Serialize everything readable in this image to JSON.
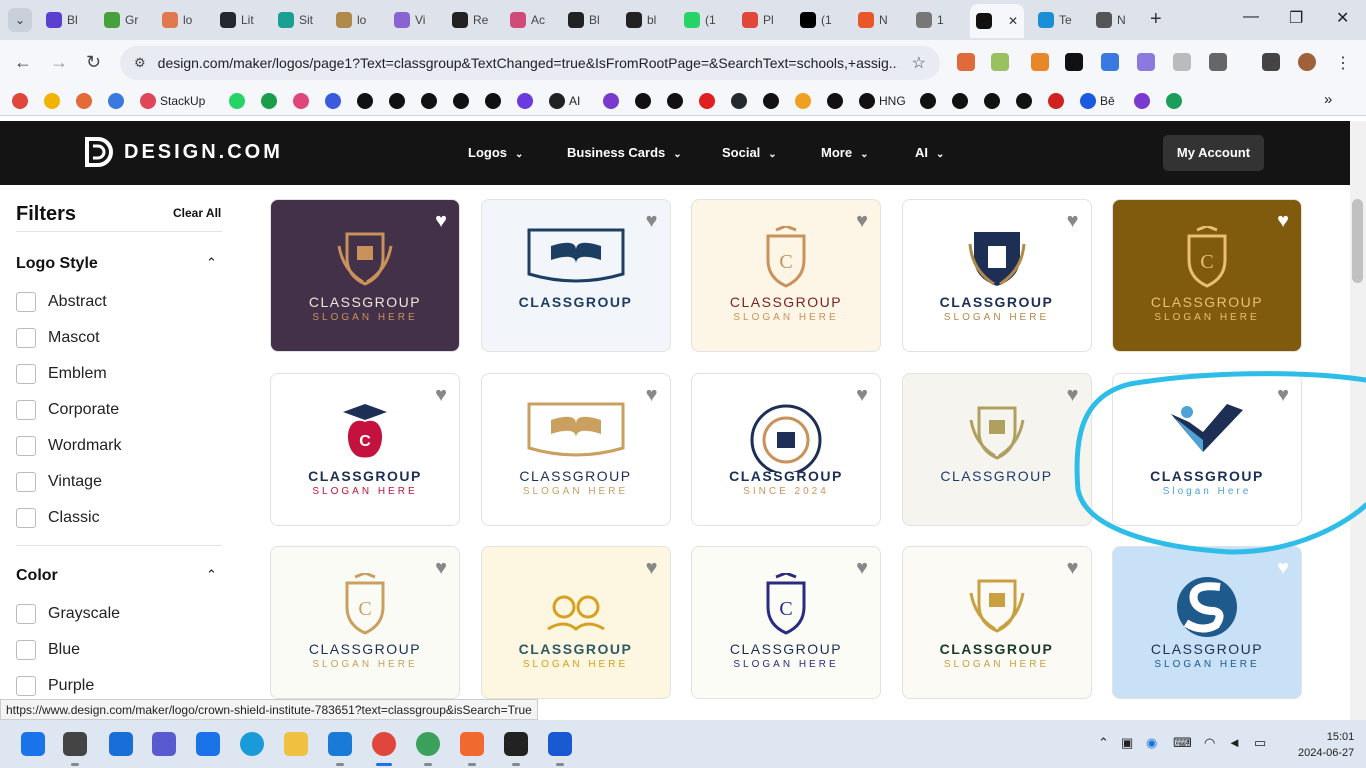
{
  "browser": {
    "tabs": [
      {
        "label": "Bl",
        "color": "#5b3fd1"
      },
      {
        "label": "Gr",
        "color": "#45a23a"
      },
      {
        "label": "lo",
        "color": "#e07a4e"
      },
      {
        "label": "Lit",
        "color": "#24292f"
      },
      {
        "label": "Sit",
        "color": "#1aa090"
      },
      {
        "label": "lo",
        "color": "#b08a4a"
      },
      {
        "label": "Vi",
        "color": "#8a63d2"
      },
      {
        "label": "Re",
        "color": "#222222"
      },
      {
        "label": "Ac",
        "color": "#d14a7a"
      },
      {
        "label": "Bl",
        "color": "#222222"
      },
      {
        "label": "bl",
        "color": "#222222"
      },
      {
        "label": "(1",
        "color": "#25d366"
      },
      {
        "label": "Pl",
        "color": "#e0463a"
      },
      {
        "label": "(1",
        "color": "#000000"
      },
      {
        "label": "N",
        "color": "#e8572a"
      },
      {
        "label": "1",
        "color": "#777777"
      },
      {
        "label": "",
        "color": "#111111"
      },
      {
        "label": "Te",
        "color": "#1a8fd8"
      },
      {
        "label": "N",
        "color": "#555555"
      }
    ],
    "active_close": "✕",
    "new_tab": "+",
    "window_controls": {
      "minimize": "—",
      "maximize": "❐",
      "close": "✕"
    },
    "url": "design.com/maker/logos/page1?Text=classgroup&TextChanged=true&IsFromRootPage=&SearchText=schools,+assig...",
    "nav": {
      "back": "←",
      "forward": "→",
      "reload": "↻",
      "star": "☆"
    },
    "bookmarks": [
      {
        "label": "",
        "color": "#e0463a"
      },
      {
        "label": "",
        "color": "#f0b400"
      },
      {
        "label": "",
        "color": "#e46a3a"
      },
      {
        "label": "",
        "color": "#3a7ae0"
      },
      {
        "label": "StackUp",
        "color": "#e0465a"
      },
      {
        "label": "",
        "color": "#25d366"
      },
      {
        "label": "",
        "color": "#1a9e4a"
      },
      {
        "label": "",
        "color": "#e0467a"
      },
      {
        "label": "",
        "color": "#3a5ae0"
      },
      {
        "label": "",
        "color": "#111111"
      },
      {
        "label": "",
        "color": "#111111"
      },
      {
        "label": "",
        "color": "#111111"
      },
      {
        "label": "",
        "color": "#111111"
      },
      {
        "label": "",
        "color": "#111111"
      },
      {
        "label": "",
        "color": "#6a3ae0"
      },
      {
        "label": "AI",
        "color": "#222222"
      },
      {
        "label": "",
        "color": "#7a3ad0"
      },
      {
        "label": "",
        "color": "#111111"
      },
      {
        "label": "",
        "color": "#111111"
      },
      {
        "label": "",
        "color": "#e02020"
      },
      {
        "label": "",
        "color": "#24292f"
      },
      {
        "label": "",
        "color": "#111111"
      },
      {
        "label": "",
        "color": "#f0a020"
      },
      {
        "label": "",
        "color": "#111111"
      },
      {
        "label": "HNG",
        "color": "#111111"
      },
      {
        "label": "",
        "color": "#111111"
      },
      {
        "label": "",
        "color": "#111111"
      },
      {
        "label": "",
        "color": "#111111"
      },
      {
        "label": "",
        "color": "#111111"
      },
      {
        "label": "",
        "color": "#d02020"
      },
      {
        "label": "Bē",
        "color": "#1a5ae0"
      },
      {
        "label": "",
        "color": "#7a3ad0"
      },
      {
        "label": "",
        "color": "#1a9e5a"
      }
    ],
    "bookmarks_more": "»",
    "status_url": "https://www.design.com/maker/logo/crown-shield-institute-783651?text=classgroup&isSearch=True"
  },
  "site": {
    "logo_text": "DESIGN.COM",
    "nav": [
      "Logos",
      "Business Cards",
      "Social",
      "More",
      "AI"
    ],
    "account_button": "My Account"
  },
  "filters": {
    "title": "Filters",
    "clear_all": "Clear All",
    "sections": [
      {
        "title": "Logo Style",
        "items": [
          "Abstract",
          "Mascot",
          "Emblem",
          "Corporate",
          "Wordmark",
          "Vintage",
          "Classic"
        ]
      },
      {
        "title": "Color",
        "items": [
          "Grayscale",
          "Blue",
          "Purple"
        ]
      }
    ]
  },
  "logos": [
    {
      "name": "CLASSGROUP",
      "slogan": "SLOGAN HERE",
      "bg": "#433049",
      "fg": "#f0e6d8",
      "accent": "#c9925a",
      "heart_white": true,
      "emblem": "crest"
    },
    {
      "name": "CLASSGROUP",
      "slogan": "",
      "bg": "#f2f6fb",
      "fg": "#1d3e63",
      "accent": "#1d3e63",
      "heart_white": false,
      "emblem": "book"
    },
    {
      "name": "CLASSGROUP",
      "slogan": "SLOGAN HERE",
      "bg": "#fdf5e6",
      "fg": "#7a2424",
      "accent": "#c9925a",
      "heart_white": false,
      "emblem": "shield"
    },
    {
      "name": "CLASSGROUP",
      "slogan": "SLOGAN HERE",
      "bg": "#ffffff",
      "fg": "#1d2f55",
      "accent": "#b08a4a",
      "heart_white": false,
      "emblem": "pillar"
    },
    {
      "name": "CLASSGROUP",
      "slogan": "SLOGAN HERE",
      "bg": "#805a0d",
      "fg": "#e8c070",
      "accent": "#e8c070",
      "heart_white": true,
      "emblem": "shield"
    },
    {
      "name": "CLASSGROUP",
      "slogan": "SLOGAN HERE",
      "bg": "#ffffff",
      "fg": "#1d2f55",
      "accent": "#c4113e",
      "heart_white": false,
      "emblem": "apple"
    },
    {
      "name": "CLASSGROUP",
      "slogan": "SLOGAN HERE",
      "bg": "#ffffff",
      "fg": "#1d2f55",
      "accent": "#c9a060",
      "heart_white": false,
      "emblem": "book"
    },
    {
      "name": "CLASSGROUP",
      "slogan": "SINCE 2024",
      "bg": "#ffffff",
      "fg": "#1d2f55",
      "accent": "#c9925a",
      "heart_white": false,
      "emblem": "circle"
    },
    {
      "name": "CLASSGROUP",
      "slogan": "",
      "bg": "#f6f4ee",
      "fg": "#1d3a6e",
      "accent": "#b0a060",
      "heart_white": false,
      "emblem": "crest"
    },
    {
      "name": "CLASSGROUP",
      "slogan": "Slogan Here",
      "bg": "#ffffff",
      "fg": "#1d2f55",
      "accent": "#4ba3d8",
      "heart_white": false,
      "emblem": "check"
    },
    {
      "name": "CLASSGROUP",
      "slogan": "SLOGAN HERE",
      "bg": "#fbfbf6",
      "fg": "#1d2f55",
      "accent": "#c9a060",
      "heart_white": false,
      "emblem": "shield"
    },
    {
      "name": "CLASSGROUP",
      "slogan": "SLOGAN HERE",
      "bg": "#fdf6e0",
      "fg": "#2f5a66",
      "accent": "#d6a020",
      "heart_white": false,
      "emblem": "kids"
    },
    {
      "name": "CLASSGROUP",
      "slogan": "SLOGAN HERE",
      "bg": "#fcfcf7",
      "fg": "#1d2f55",
      "accent": "#2a2a80",
      "heart_white": false,
      "emblem": "shield"
    },
    {
      "name": "CLASSGROUP",
      "slogan": "SLOGAN HERE",
      "bg": "#fbfaf5",
      "fg": "#1a3a2a",
      "accent": "#c9a040",
      "heart_white": false,
      "emblem": "crest"
    },
    {
      "name": "CLASSGROUP",
      "slogan": "SLOGAN HERE",
      "bg": "#c8e1f6",
      "fg": "#1d2f55",
      "accent": "#1f5a8c",
      "heart_white": true,
      "emblem": "s"
    }
  ],
  "taskbar": {
    "apps": [
      {
        "name": "start",
        "color": "#1a73e8"
      },
      {
        "name": "file-explorer-dark",
        "color": "#444444"
      },
      {
        "name": "widgets",
        "color": "#1a6ed8"
      },
      {
        "name": "teams",
        "color": "#5a5ad0"
      },
      {
        "name": "store",
        "color": "#1a73e8"
      },
      {
        "name": "edge",
        "color": "#1a9ad8"
      },
      {
        "name": "folder",
        "color": "#f0c040"
      },
      {
        "name": "vscode",
        "color": "#1a7ad8"
      },
      {
        "name": "chrome",
        "color": "#e0463a"
      },
      {
        "name": "chrome-2",
        "color": "#3aa05a"
      },
      {
        "name": "postman",
        "color": "#f06a30"
      },
      {
        "name": "terminal",
        "color": "#222222"
      },
      {
        "name": "word",
        "color": "#1a5ad0"
      }
    ],
    "time": "15:01",
    "date": "2024-06-27"
  }
}
